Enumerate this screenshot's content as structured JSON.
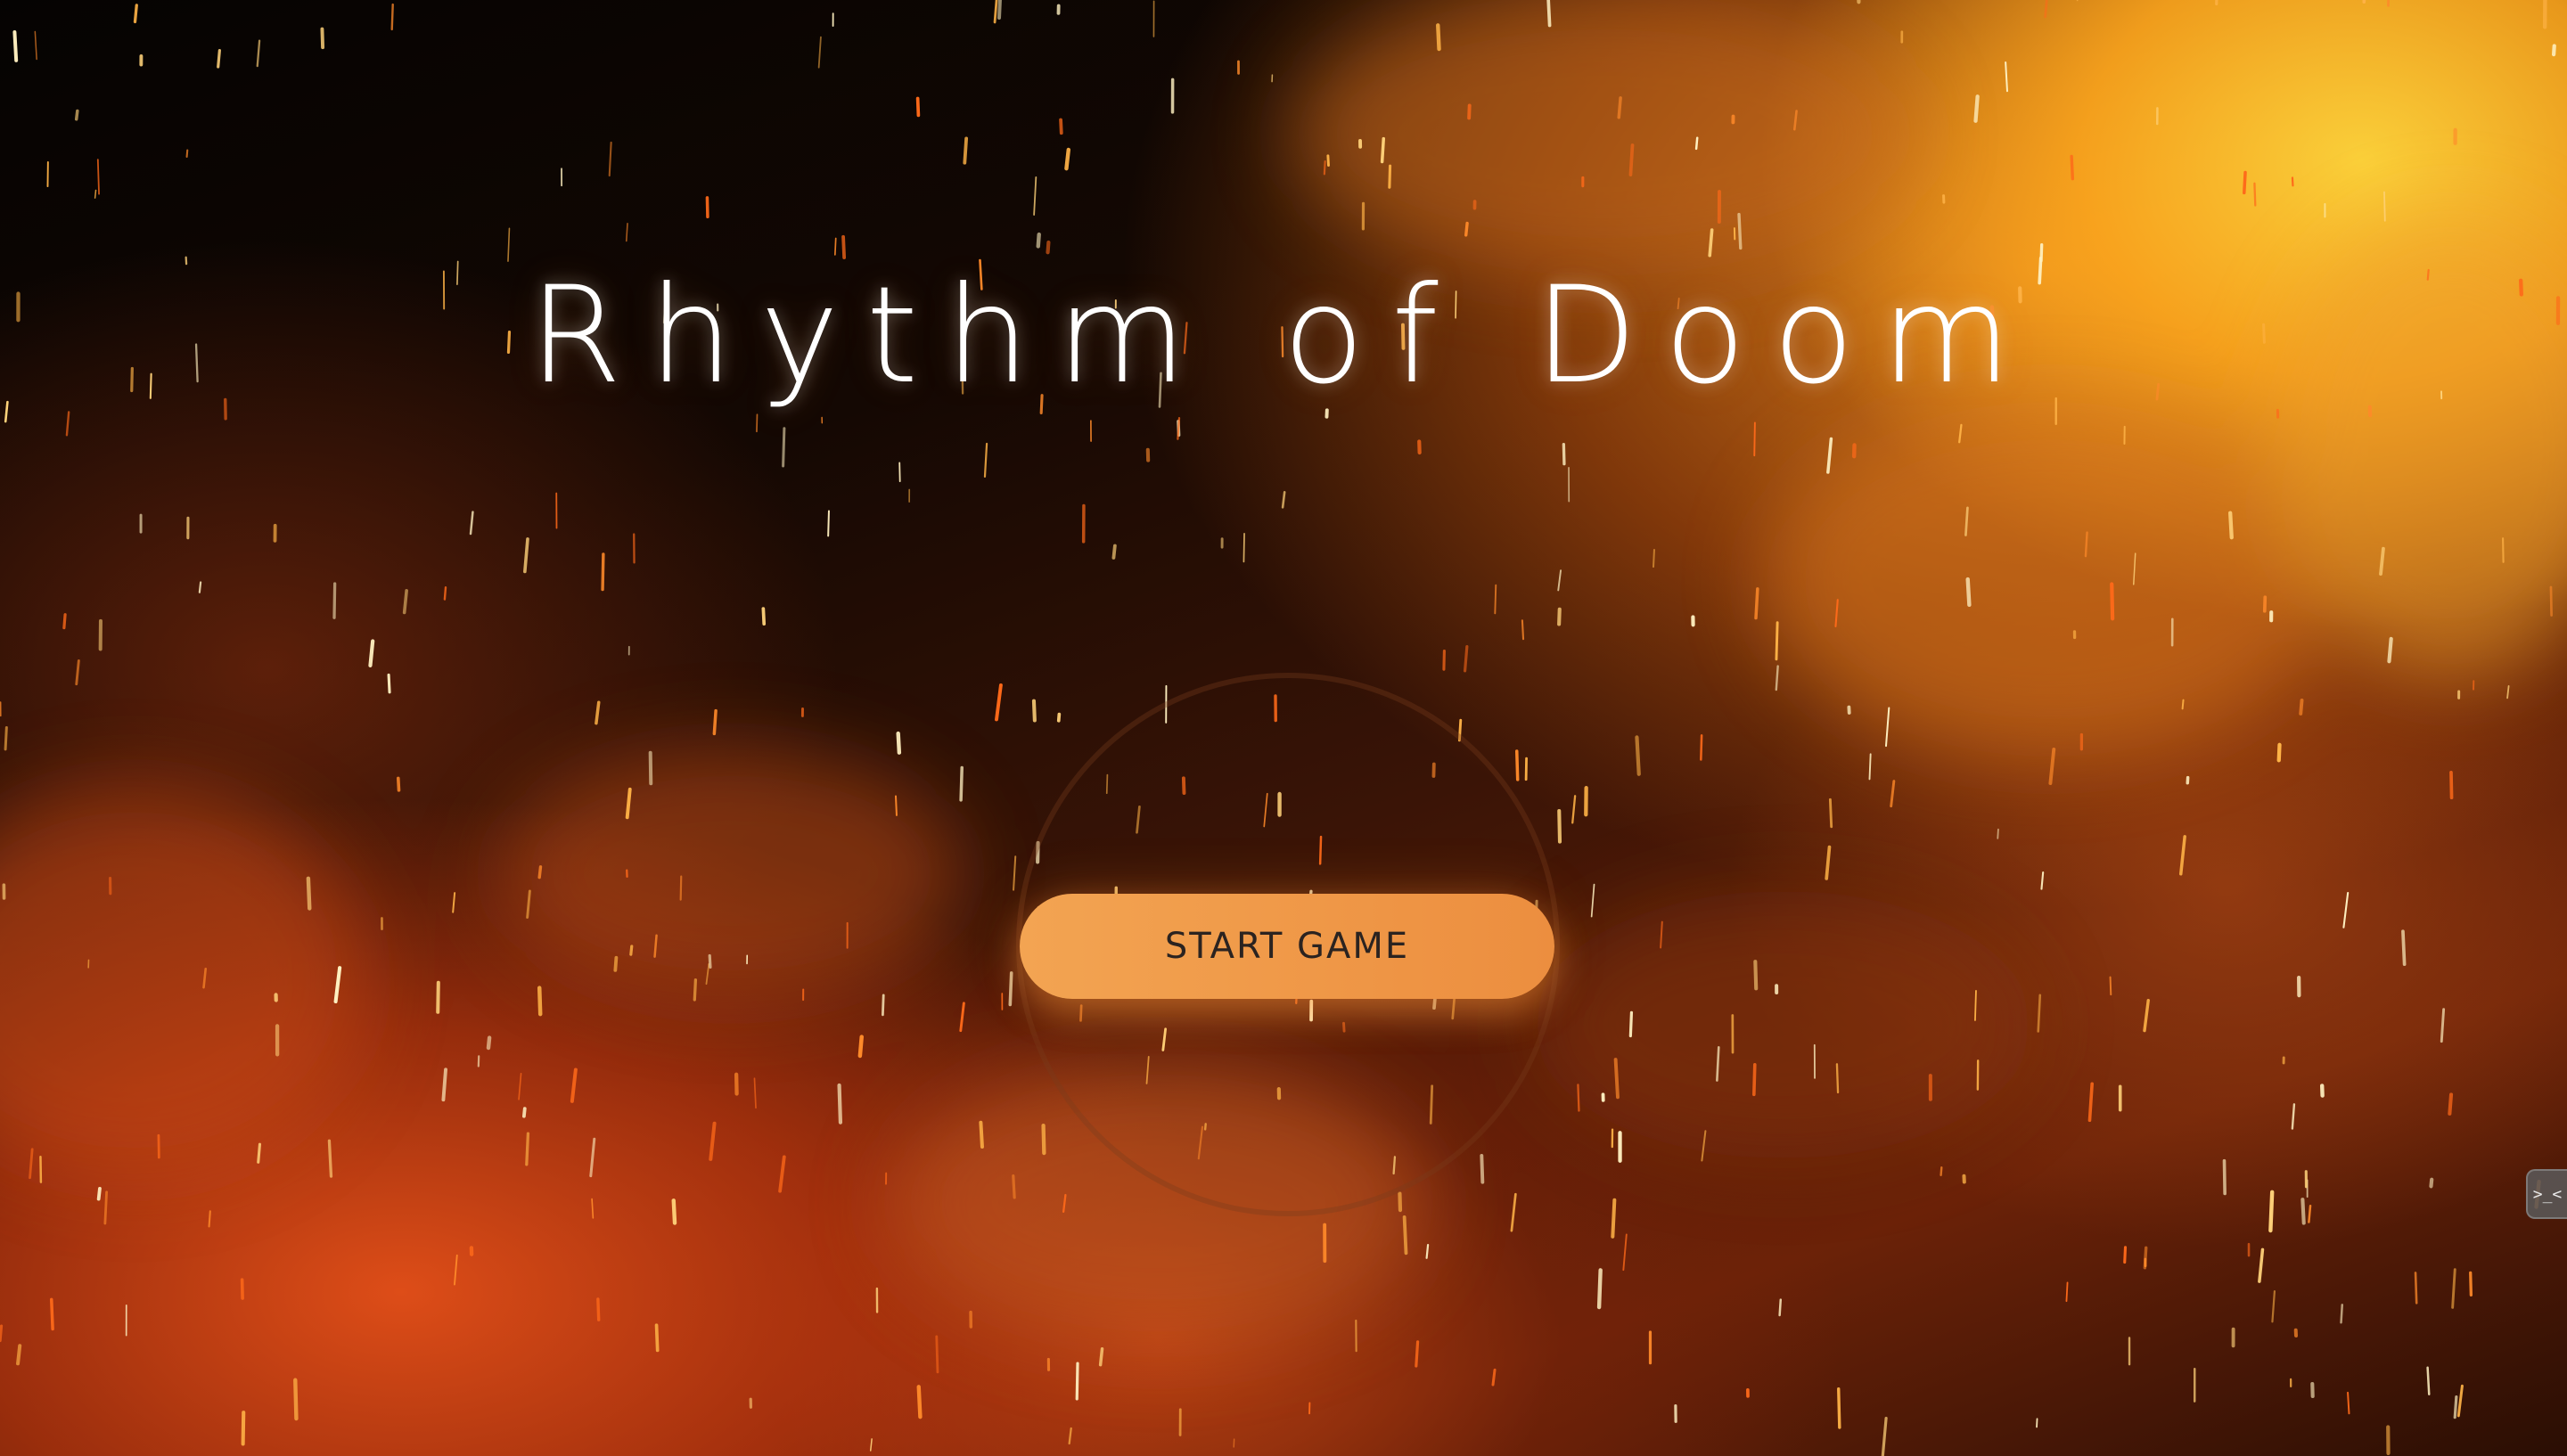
{
  "game": {
    "title": "Rhythm of Doom",
    "start_button_label": "START GAME"
  },
  "side_tab": {
    "glyph": ">_<",
    "icon": "terminal-icon"
  },
  "colors": {
    "button": "#f3a452",
    "button_text": "#2b2320",
    "title": "#ffffff",
    "ember": "#ffb347"
  }
}
